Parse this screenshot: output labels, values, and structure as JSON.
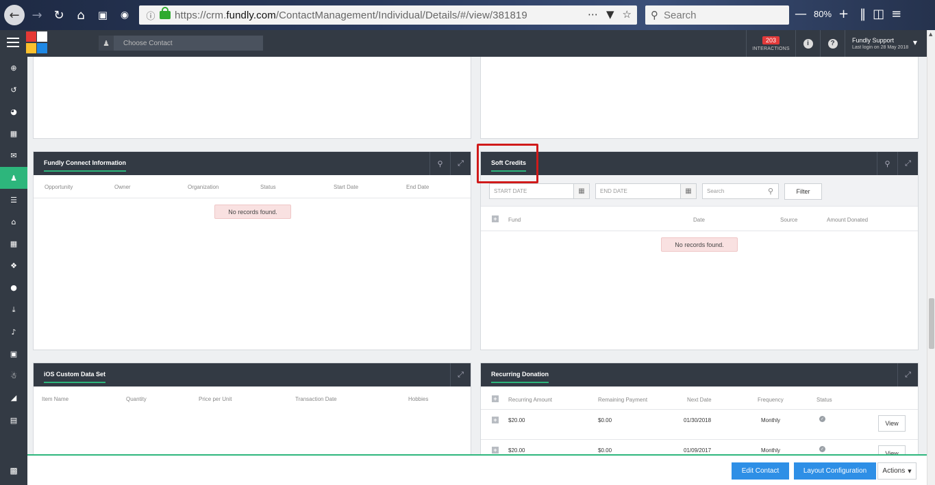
{
  "browser": {
    "url_prefix": "https://crm.",
    "url_host": "fundly.com",
    "url_path": "/ContactManagement/Individual/Details/#/view/381819",
    "search_placeholder": "Search",
    "zoom": "80%"
  },
  "header": {
    "choose_contact": "Choose Contact",
    "interactions_count": "203",
    "interactions_label": "INTERACTIONS",
    "user_name": "Fundly Support",
    "last_login": "Last login on 28 May 2018"
  },
  "fundly_connect": {
    "title": "Fundly Connect Information",
    "columns": [
      "Opportunity",
      "Owner",
      "Organization",
      "Status",
      "Start Date",
      "End Date"
    ],
    "empty": "No records found."
  },
  "soft_credits": {
    "title": "Soft Credits",
    "start_date_placeholder": "START DATE",
    "end_date_placeholder": "END DATE",
    "search_placeholder": "Search",
    "filter_label": "Filter",
    "columns": [
      "Fund",
      "Date",
      "Source",
      "Amount Donated"
    ],
    "empty": "No records found."
  },
  "ios_custom": {
    "title": "iOS Custom Data Set",
    "columns": [
      "Item Name",
      "Quantity",
      "Price per Unit",
      "Transaction Date",
      "Hobbies"
    ]
  },
  "recurring": {
    "title": "Recurring Donation",
    "columns": [
      "Recurring Amount",
      "Remaining Payment",
      "Next Date",
      "Frequency",
      "Status"
    ],
    "rows": [
      {
        "amount": "$20.00",
        "remaining": "$0.00",
        "next": "01/30/2018",
        "frequency": "Monthly",
        "view": "View"
      },
      {
        "amount": "$20.00",
        "remaining": "$0.00",
        "next": "01/09/2017",
        "frequency": "Monthly",
        "view": "View"
      }
    ]
  },
  "footer": {
    "edit_contact": "Edit Contact",
    "layout_configuration": "Layout Configuration",
    "actions": "Actions"
  },
  "colors": {
    "header_bg": "#333a44",
    "accent_green": "#2db67c",
    "primary_blue": "#2e8fe6",
    "highlight_red": "#d01a1a"
  }
}
